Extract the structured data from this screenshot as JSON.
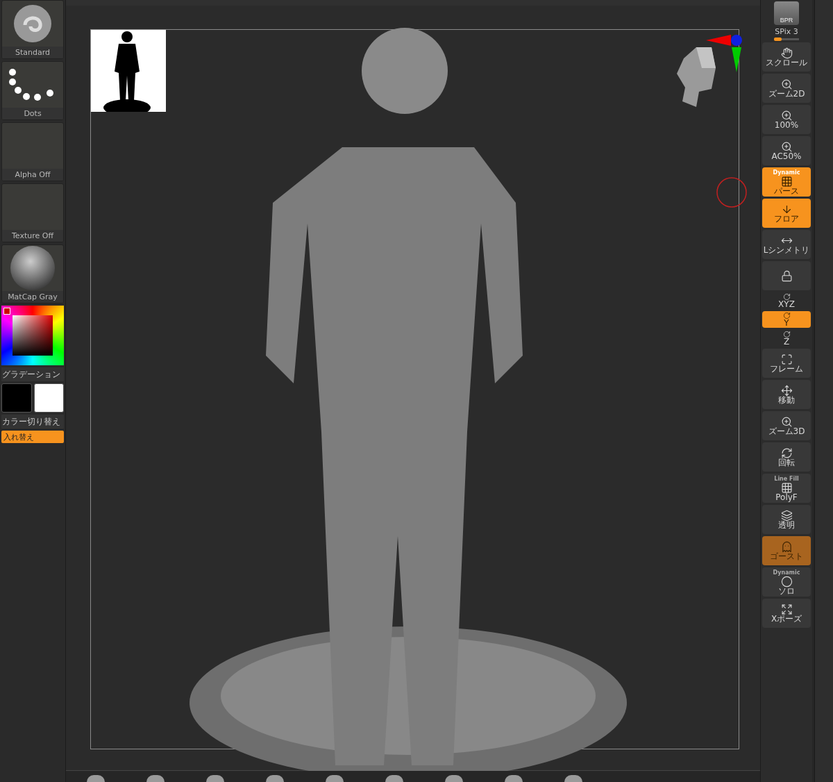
{
  "left_panel": {
    "tiles": [
      {
        "kind": "brush",
        "label": "Standard"
      },
      {
        "kind": "stroke",
        "label": "Dots"
      },
      {
        "kind": "empty",
        "label": "Alpha Off"
      },
      {
        "kind": "empty",
        "label": "Texture Off"
      },
      {
        "kind": "matcap",
        "label": "MatCap Gray"
      }
    ],
    "gradient_label": "グラデーション",
    "switch_label": "カラー切り替え",
    "swap_button": "入れ替え"
  },
  "right_toolbar": {
    "bpr": "BPR",
    "spix": {
      "label": "SPix 3",
      "level": 0.3
    },
    "buttons": [
      {
        "kind": "scroll",
        "label": "スクロール",
        "on": false
      },
      {
        "kind": "zoom",
        "label": "ズーム2D",
        "on": false
      },
      {
        "kind": "zoom",
        "label": "100%",
        "on": false
      },
      {
        "kind": "zoom",
        "label": "AC50%",
        "on": false
      },
      {
        "kind": "perspective",
        "badge": "Dynamic",
        "label": "パース",
        "on": true
      },
      {
        "kind": "floor",
        "label": "フロア",
        "on": true
      },
      {
        "kind": "symmetry",
        "label": "Lシンメトリ",
        "on": false
      },
      {
        "kind": "lock",
        "on": false
      },
      {
        "kind": "small",
        "label": "XYZ",
        "on": false
      },
      {
        "kind": "small",
        "label": "Y",
        "on": true
      },
      {
        "kind": "small",
        "label": "Z",
        "on": false
      },
      {
        "kind": "frame",
        "label": "フレーム",
        "on": false
      },
      {
        "kind": "move",
        "label": "移動",
        "on": false
      },
      {
        "kind": "zoom",
        "label": "ズーム3D",
        "on": false
      },
      {
        "kind": "rotate",
        "label": "回転",
        "on": false
      },
      {
        "kind": "polyframe",
        "badge": "Line Fill",
        "label": "PolyF",
        "on": false
      },
      {
        "kind": "transparent",
        "label": "透明",
        "on": false
      },
      {
        "kind": "ghost",
        "label": "ゴースト",
        "on": true
      },
      {
        "kind": "solo",
        "badge": "Dynamic",
        "label": "ソロ",
        "on": false
      },
      {
        "kind": "xpose",
        "label": "Xポーズ",
        "on": false
      }
    ]
  }
}
